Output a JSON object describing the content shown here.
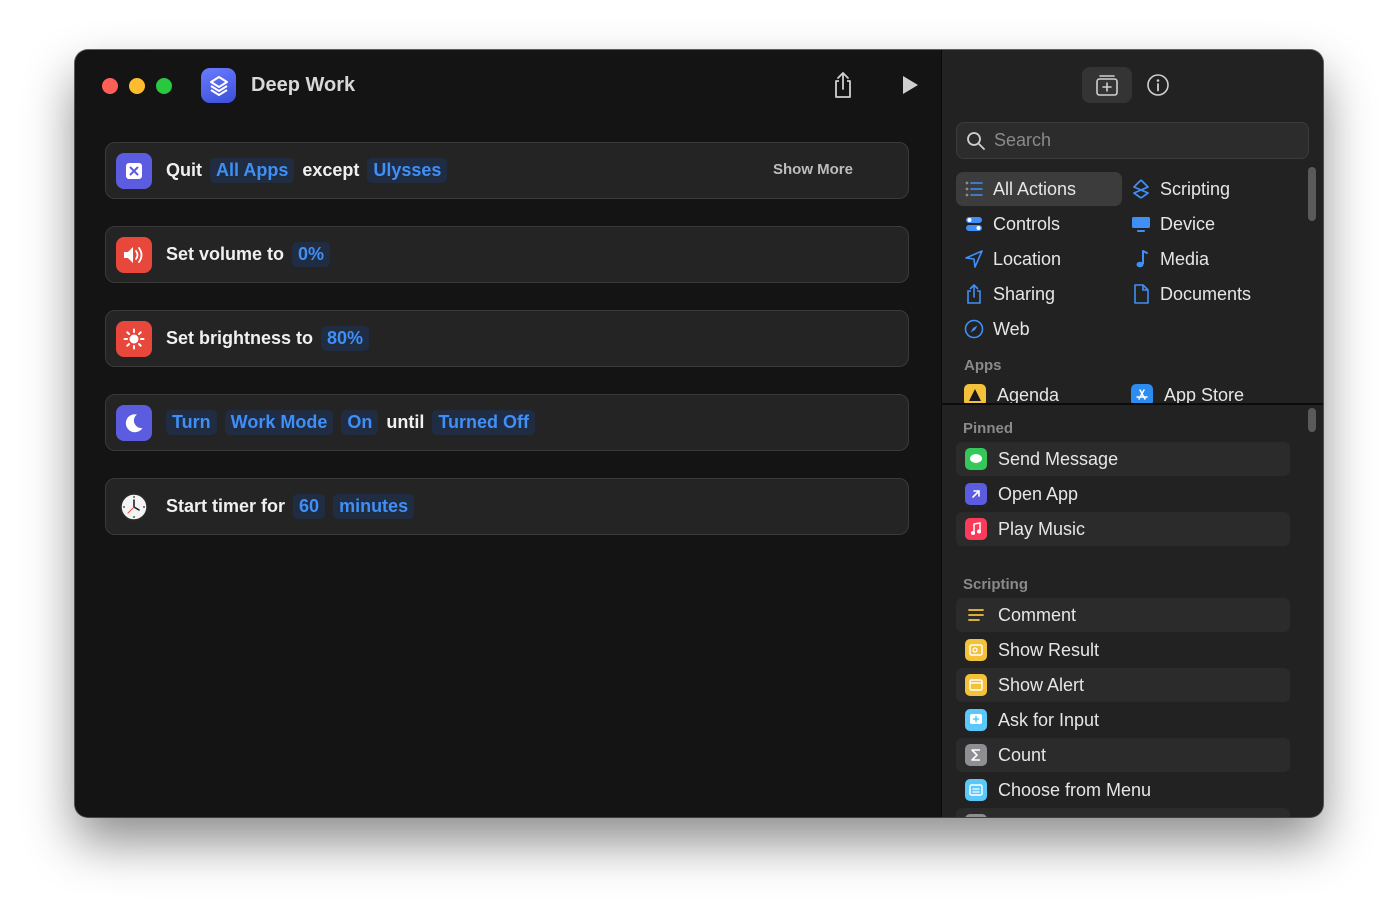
{
  "window": {
    "title": "Deep Work"
  },
  "actions": {
    "quit": {
      "verb": "Quit",
      "target": "All Apps",
      "mid": "except",
      "exception": "Ulysses",
      "show_more": "Show More"
    },
    "volume": {
      "text": "Set volume to",
      "value": "0%"
    },
    "brightness": {
      "text": "Set brightness to",
      "value": "80%"
    },
    "focus": {
      "verb": "Turn",
      "mode": "Work Mode",
      "state": "On",
      "mid": "until",
      "end": "Turned Off"
    },
    "timer": {
      "text": "Start timer for",
      "value": "60",
      "unit": "minutes"
    }
  },
  "sidebar": {
    "search_placeholder": "Search",
    "categories": {
      "all_actions": "All Actions",
      "scripting": "Scripting",
      "controls": "Controls",
      "device": "Device",
      "location": "Location",
      "media": "Media",
      "sharing": "Sharing",
      "documents": "Documents",
      "web": "Web"
    },
    "apps_label": "Apps",
    "apps": {
      "agenda": "Agenda",
      "app_store": "App Store"
    },
    "pinned_label": "Pinned",
    "pinned": {
      "send_message": "Send Message",
      "open_app": "Open App",
      "play_music": "Play Music"
    },
    "scripting_label": "Scripting",
    "scripting_items": {
      "comment": "Comment",
      "show_result": "Show Result",
      "show_alert": "Show Alert",
      "ask_for_input": "Ask for Input",
      "count": "Count",
      "choose_from_menu": "Choose from Menu"
    }
  },
  "colors": {
    "accent": "#3f8ff7",
    "quit_icon": "#5b5ce0",
    "volume_icon": "#e8483b",
    "brightness_icon": "#e8483b",
    "focus_icon": "#5b5ce0"
  }
}
